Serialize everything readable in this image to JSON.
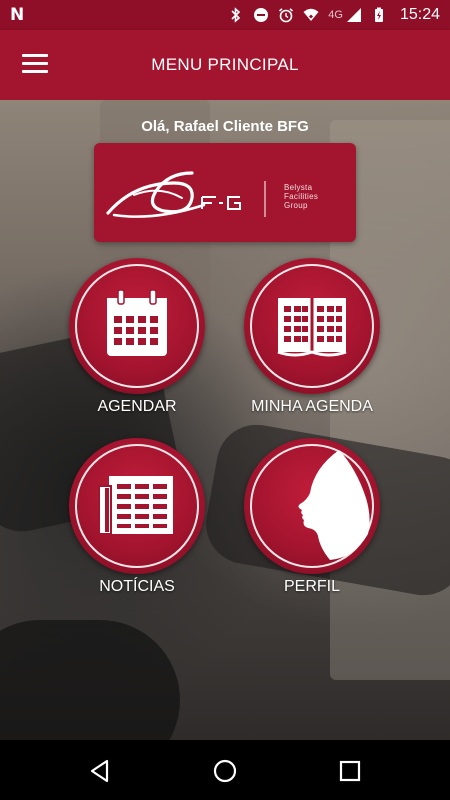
{
  "status_bar": {
    "left_icon": "n-notification-icon",
    "network_label": "4G",
    "time": "15:24",
    "icons": [
      "bluetooth-icon",
      "do-not-disturb-icon",
      "alarm-icon",
      "wifi-icon",
      "cell-signal-icon",
      "battery-charging-icon"
    ]
  },
  "app_bar": {
    "title": "MENU PRINCIPAL",
    "menu_icon": "hamburger-menu-icon"
  },
  "main": {
    "greeting": "Olá, Rafael Cliente BFG",
    "logo": {
      "mark": "BFG",
      "tagline_lines": [
        "Belysta",
        "Facilities",
        "Group"
      ]
    },
    "tiles": [
      {
        "label": "AGENDAR",
        "icon": "calendar-icon"
      },
      {
        "label": "MINHA AGENDA",
        "icon": "open-agenda-book-icon"
      },
      {
        "label": "NOTÍCIAS",
        "icon": "newspaper-icon"
      },
      {
        "label": "PERFIL",
        "icon": "profile-silhouette-icon"
      }
    ]
  },
  "nav_bar": {
    "buttons": [
      "back-icon",
      "home-icon",
      "recents-icon"
    ]
  },
  "colors": {
    "primary": "#a3142e",
    "primary_dark": "#8e0f27",
    "text": "#ffffff"
  }
}
